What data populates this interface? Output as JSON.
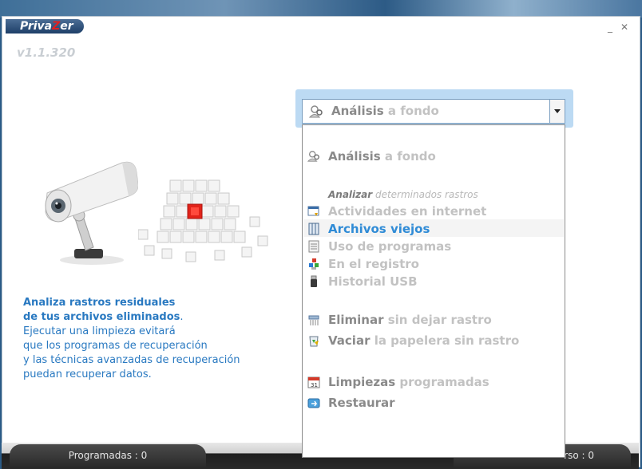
{
  "app": {
    "title_prefix": "Priva",
    "title_z": "Z",
    "title_suffix": "er",
    "version": "v1.1.320"
  },
  "window_controls": {
    "minimize": "_",
    "close": "✕"
  },
  "description": {
    "line1": "Analiza rastros residuales",
    "line2a": "de tus archivos eliminados",
    "line2b": ".",
    "line3": "Ejecutar una limpieza evitará",
    "line4": "que los programas de recuperación",
    "line5": "y las técnicas avanzadas de recuperación",
    "line6": "puedan recuperar datos."
  },
  "combo": {
    "bold": "Análisis",
    "light": " a fondo",
    "icon": "search-person-icon"
  },
  "dropdown": {
    "deep_scan": {
      "bold": "Análisis",
      "light": " a fondo",
      "icon": "search-person-icon"
    },
    "subhead": {
      "a": "Analizar",
      "b": " determinados rastros"
    },
    "internet": {
      "label": "Actividades en internet",
      "icon": "internet-window-icon"
    },
    "old_files": {
      "label": "Archivos viejos",
      "icon": "file-cabinet-icon"
    },
    "programs": {
      "label": "Uso de programas",
      "icon": "program-list-icon"
    },
    "registry": {
      "label": "En el registro",
      "icon": "registry-blocks-icon"
    },
    "usb": {
      "label": "Historial USB",
      "icon": "usb-drive-icon"
    },
    "delete": {
      "bold": "Eliminar",
      "light": " sin dejar rastro",
      "icon": "shredder-icon"
    },
    "empty_bin": {
      "bold": "Vaciar",
      "light": " la papelera sin rastro",
      "icon": "recycle-bin-icon"
    },
    "scheduled": {
      "bold": "Limpiezas",
      "light": " programadas",
      "icon": "calendar-icon"
    },
    "restore": {
      "label": "Restaurar",
      "icon": "restore-icon"
    }
  },
  "status": {
    "scheduled": "Programadas : 0",
    "right": "rso : 0"
  },
  "colors": {
    "accent": "#2979c1",
    "highlight_item": "#2f8bd6",
    "combo_frame": "#bcdaf3"
  }
}
